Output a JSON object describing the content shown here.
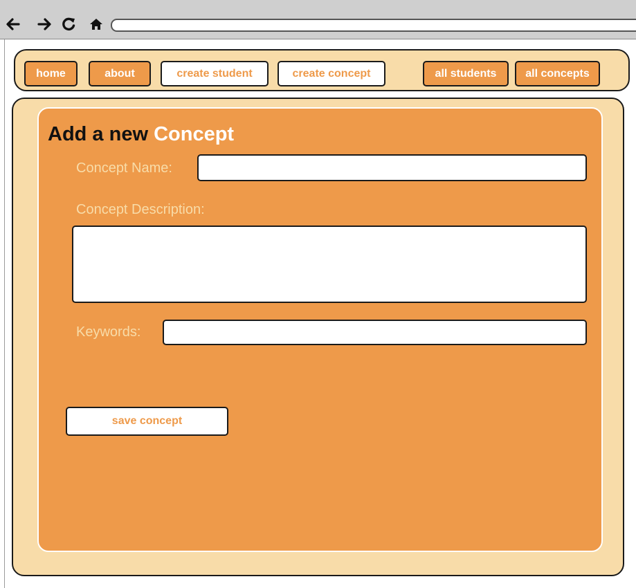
{
  "browser": {
    "back_icon": "arrow-left-icon",
    "forward_icon": "arrow-right-icon",
    "reload_icon": "reload-icon",
    "home_icon": "home-icon",
    "address": ""
  },
  "nav": {
    "items": [
      {
        "label": "home",
        "style": "orange"
      },
      {
        "label": "about",
        "style": "orange"
      },
      {
        "label": "create student",
        "style": "white"
      },
      {
        "label": "create concept",
        "style": "white"
      },
      {
        "label": "all students",
        "style": "orange"
      },
      {
        "label": "all concepts",
        "style": "orange"
      }
    ]
  },
  "form": {
    "title_prefix": "Add a new",
    "title_accent": "Concept",
    "name_label": "Concept Name:",
    "name_value": "",
    "description_label": "Concept Description:",
    "description_value": "",
    "keywords_label": "Keywords:",
    "keywords_value": "",
    "save_label": "save concept"
  },
  "colors": {
    "accent_orange": "#ee9a4a",
    "panel_cream": "#f8dca9",
    "border": "#1a1a1a"
  }
}
